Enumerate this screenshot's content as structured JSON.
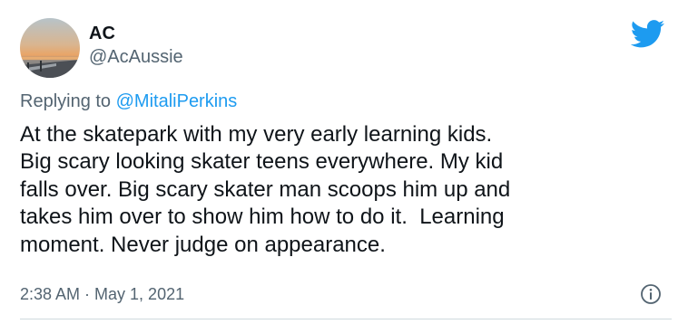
{
  "tweet": {
    "author": {
      "display_name": "AC",
      "handle": "@AcAussie"
    },
    "reply_prefix": "Replying to ",
    "reply_to_handle": "@MitaliPerkins",
    "text": "At the skatepark with my very early learning kids.\nBig scary looking skater teens everywhere. My kid\nfalls over. Big scary skater man scoops him up and\ntakes him over to show him how to do it.  Learning\nmoment. Never judge on appearance.",
    "timestamp": "2:38 AM · May 1, 2021"
  },
  "icons": {
    "brand": "twitter-bird-icon",
    "info": "info-icon"
  },
  "colors": {
    "brand_blue": "#1d9bf0",
    "text_primary": "#0f1419",
    "text_secondary": "#536471",
    "divider": "#cfd9de"
  }
}
